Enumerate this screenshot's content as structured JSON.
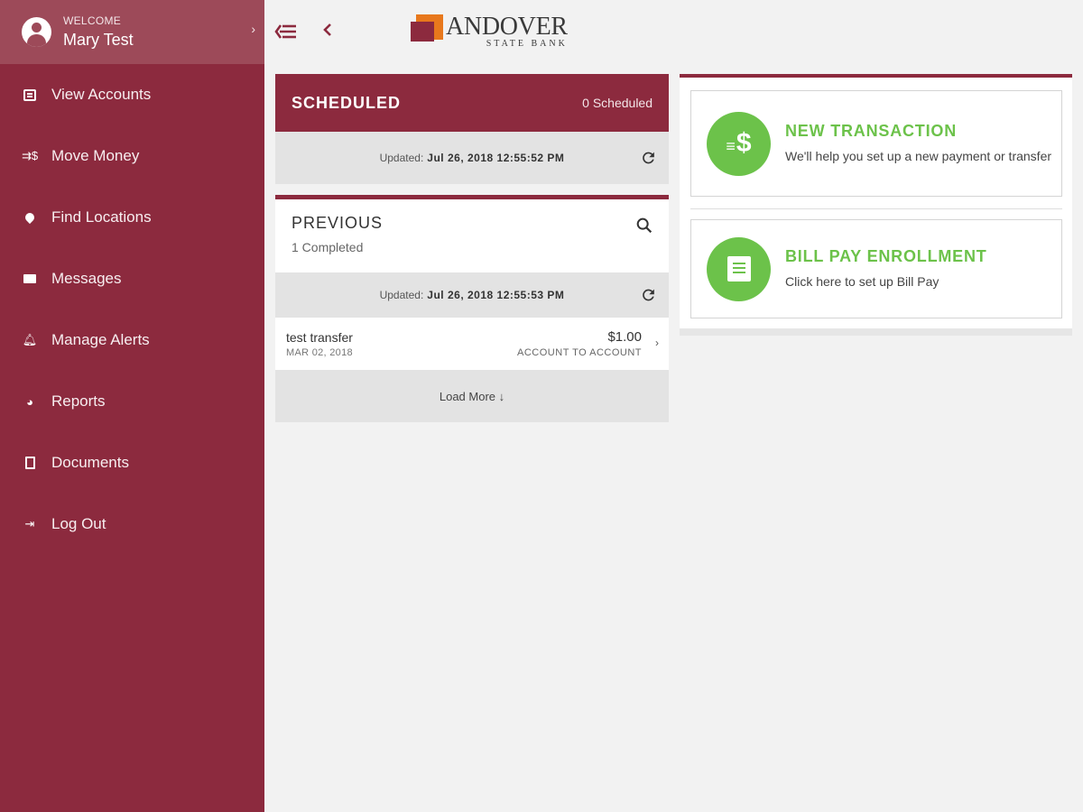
{
  "profile": {
    "welcome": "WELCOME",
    "name": "Mary Test",
    "icon": "account-circle-icon"
  },
  "nav": {
    "items": [
      {
        "label": "View Accounts",
        "icon": "accounts-icon"
      },
      {
        "label": "Move Money",
        "icon": "move-money-icon"
      },
      {
        "label": "Find Locations",
        "icon": "location-pin-icon"
      },
      {
        "label": "Messages",
        "icon": "mail-icon"
      },
      {
        "label": "Manage Alerts",
        "icon": "bell-icon"
      },
      {
        "label": "Reports",
        "icon": "pie-chart-icon"
      },
      {
        "label": "Documents",
        "icon": "document-icon"
      },
      {
        "label": "Log Out",
        "icon": "logout-icon"
      }
    ]
  },
  "brand": {
    "name": "ANDOVER",
    "sub": "STATE BANK",
    "colors": {
      "primary": "#8c2a3e",
      "accent": "#e8781c",
      "action": "#6cc24a"
    }
  },
  "scheduled": {
    "title": "SCHEDULED",
    "count": "0 Scheduled",
    "updated_label": "Updated:",
    "updated_value": "Jul 26, 2018 12:55:52 PM"
  },
  "previous": {
    "title": "PREVIOUS",
    "count": "1 Completed",
    "updated_label": "Updated:",
    "updated_value": "Jul 26, 2018 12:55:53 PM",
    "transactions": [
      {
        "name": "test transfer",
        "date": "MAR 02, 2018",
        "amount": "$1.00",
        "type": "ACCOUNT TO ACCOUNT"
      }
    ],
    "load_more": "Load More ↓"
  },
  "actions": {
    "new_transaction": {
      "title": "NEW TRANSACTION",
      "desc": "We'll help you set up a new payment or transfer"
    },
    "bill_pay": {
      "title": "BILL PAY ENROLLMENT",
      "desc": "Click here to set up Bill Pay"
    }
  }
}
